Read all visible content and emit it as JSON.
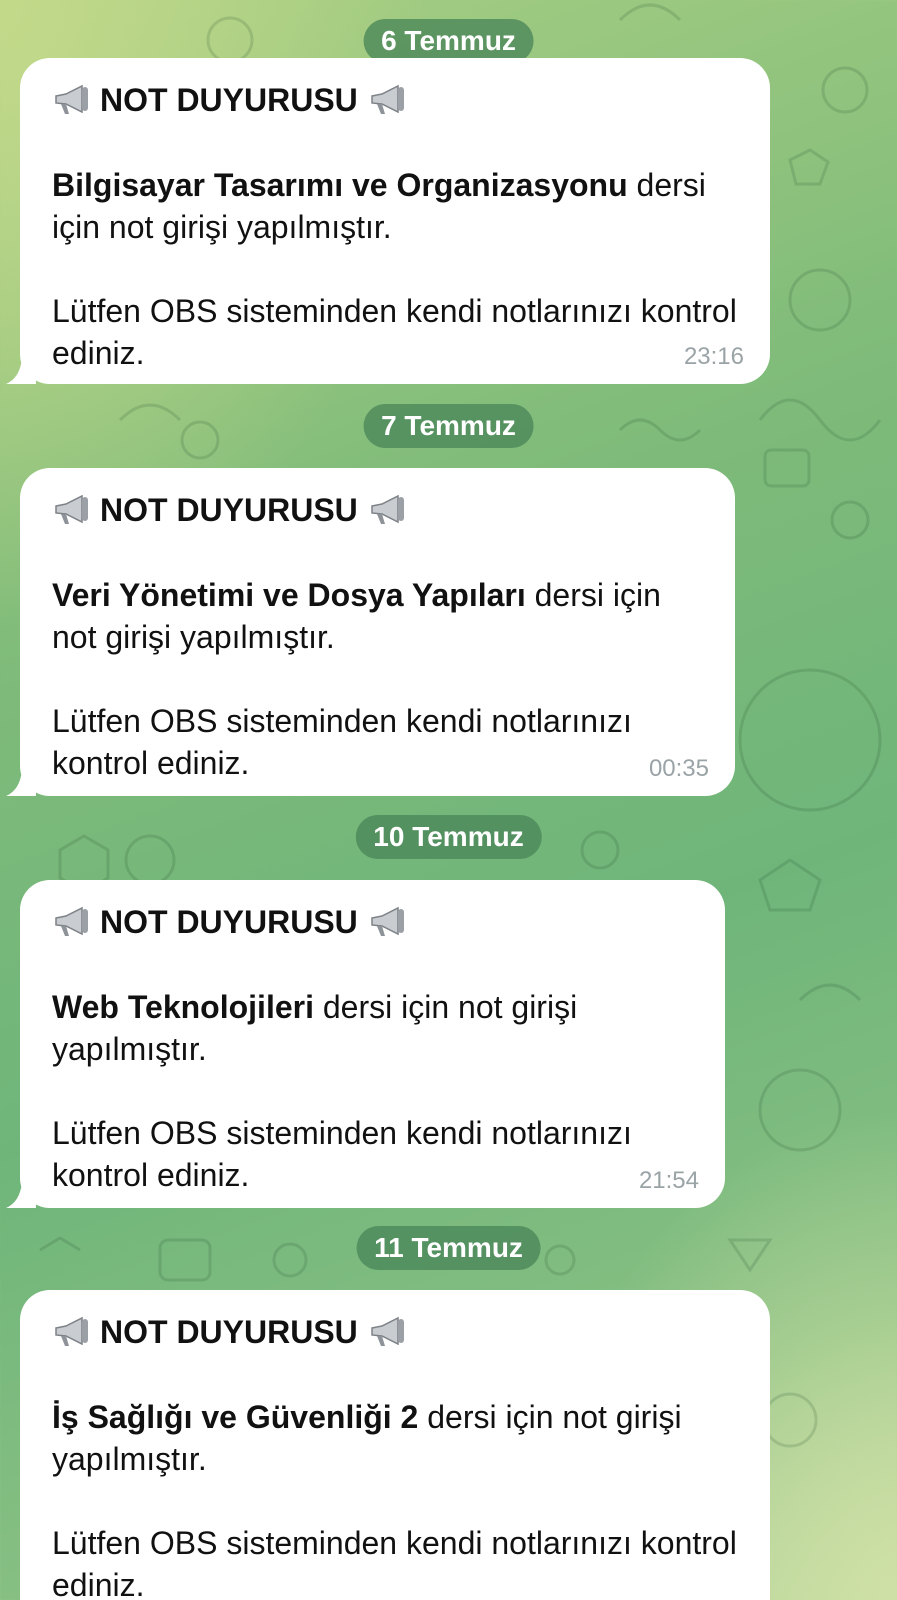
{
  "messages": [
    {
      "date": "6 Temmuz",
      "title": "NOT DUYURUSU",
      "course": "Bilgisayar Tasarımı ve Organizasyonu",
      "course_suffix": " dersi için not girişi yapılmıştır.",
      "body": "Lütfen OBS sisteminden kendi notlarınızı kontrol ediniz.",
      "time": "23:16"
    },
    {
      "date": "7 Temmuz",
      "title": "NOT DUYURUSU",
      "course": "Veri Yönetimi ve Dosya Yapıları",
      "course_suffix": " dersi için not girişi yapılmıştır.",
      "body": "Lütfen OBS sisteminden kendi notlarınızı kontrol ediniz.",
      "time": "00:35"
    },
    {
      "date": "10 Temmuz",
      "title": "NOT DUYURUSU",
      "course": "Web Teknolojileri",
      "course_suffix": " dersi için not girişi yapılmıştır.",
      "body": "Lütfen OBS sisteminden kendi notlarınızı kontrol ediniz.",
      "time": "21:54"
    },
    {
      "date": "11 Temmuz",
      "title": "NOT DUYURUSU",
      "course": "İş Sağlığı ve Güvenliği 2",
      "course_suffix": " dersi için not girişi yapılmıştır.",
      "body": "Lütfen OBS sisteminden kendi notlarınızı kontrol ediniz.",
      "time": ""
    }
  ],
  "icons": {
    "title_icon": "megaphone-icon"
  },
  "colors": {
    "bubble": "#ffffff",
    "date_pill": "#4a8658",
    "timestamp": "#9aa3a6"
  }
}
